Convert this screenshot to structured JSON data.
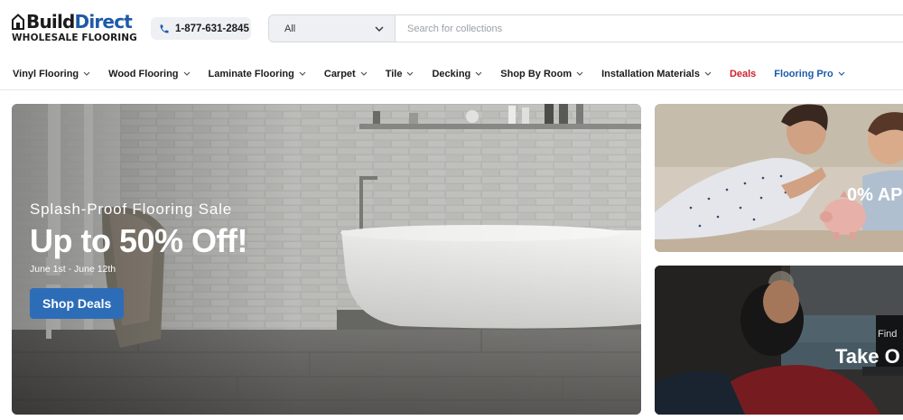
{
  "header": {
    "logo": {
      "brand_part1": "Build",
      "brand_part2": "Direct",
      "tagline": "WHOLESALE FLOORING"
    },
    "phone": "1-877-631-2845",
    "search": {
      "category": "All",
      "placeholder": "Search for collections"
    }
  },
  "nav": {
    "items": [
      {
        "label": "Vinyl Flooring"
      },
      {
        "label": "Wood Flooring"
      },
      {
        "label": "Laminate Flooring"
      },
      {
        "label": "Carpet"
      },
      {
        "label": "Tile"
      },
      {
        "label": "Decking"
      },
      {
        "label": "Shop By Room"
      },
      {
        "label": "Installation Materials"
      },
      {
        "label": "Deals"
      },
      {
        "label": "Flooring Pro"
      }
    ]
  },
  "hero": {
    "eyebrow": "Splash-Proof Flooring Sale",
    "headline": "Up to 50% Off!",
    "dates": "June 1st - June 12th",
    "cta": "Shop Deals"
  },
  "promo_cards": [
    {
      "headline": "0% AP"
    },
    {
      "eyebrow": "Find",
      "headline": "Take O"
    }
  ],
  "colors": {
    "brand_blue": "#1e5aa8",
    "deals_red": "#d0202d",
    "cta_blue": "#2d6db8"
  }
}
